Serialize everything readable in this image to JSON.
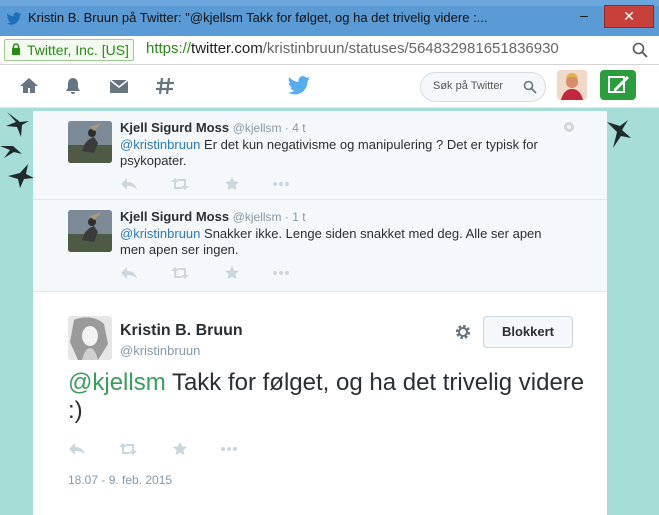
{
  "window": {
    "title": "Kristin B. Bruun på Twitter: \"@kjellsm Takk for følget, og ha det trivelig videre :...",
    "minimize_label": "–",
    "close_label": "✕"
  },
  "urlbar": {
    "site_identity": "Twitter, Inc. [US]",
    "url_scheme": "https://",
    "url_host": "twitter.com",
    "url_path": "/kristinbruun/statuses/564832981651836930"
  },
  "nav": {
    "search_placeholder": "Søk på Twitter",
    "icons": [
      "home-icon",
      "notifications-icon",
      "messages-icon",
      "discover-icon",
      "twitter-bird-icon",
      "search-icon",
      "compose-icon"
    ]
  },
  "replies": [
    {
      "author": "Kjell Sigurd Moss",
      "handle": "@kjellsm",
      "time": "4 t",
      "mention": "@kristinbruun",
      "text": " Er det kun negativisme og manipulering ? Det er typisk for psykopater."
    },
    {
      "author": "Kjell Sigurd Moss",
      "handle": "@kjellsm",
      "time": "1 t",
      "mention": "@kristinbruun",
      "text": " Snakker ikke. Lenge siden snakket med deg. Alle ser apen men apen ser ingen."
    }
  ],
  "main_tweet": {
    "author": "Kristin B. Bruun",
    "handle": "@kristinbruun",
    "blocked_label": "Blokkert",
    "mention": "@kjellsm",
    "text": " Takk for følget, og ha det trivelig videre :)",
    "timestamp": "18.07 - 9. feb. 2015"
  },
  "colors": {
    "titlebar": "#5b9bd5",
    "close": "#c7413a",
    "background": "#a7ddd7",
    "twitter_blue": "#55acee",
    "mention_blue": "#2b7bb9",
    "mention_green": "#3a9d5c",
    "compose_green": "#2a9d3c"
  }
}
